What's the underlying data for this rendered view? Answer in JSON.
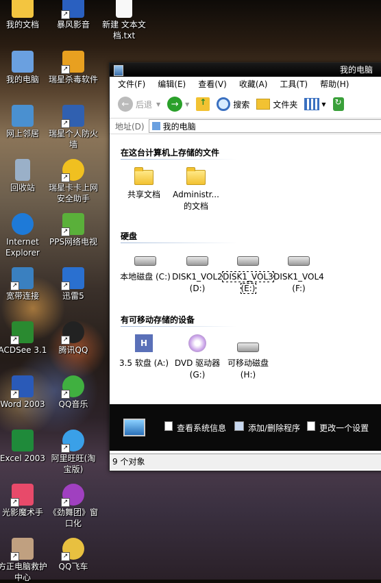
{
  "desktop": {
    "icons": [
      {
        "label": "我的文档",
        "color": "#f3c540"
      },
      {
        "label": "暴风影音",
        "color": "#2a60c0"
      },
      {
        "label": "新建 文本文档.txt",
        "color": "#f8f8f8"
      },
      {
        "label": "我的电脑",
        "color": "#6aa0e0"
      },
      {
        "label": "瑞星杀毒软件",
        "color": "#e8a020"
      },
      {
        "label": "网上邻居",
        "color": "#4a90d0"
      },
      {
        "label": "瑞星个人防火墙",
        "color": "#3060b0"
      },
      {
        "label": "回收站",
        "color": "#9ab0c8"
      },
      {
        "label": "瑞星卡卡上网安全助手",
        "color": "#f0c020"
      },
      {
        "label": "Internet Explorer",
        "color": "#1e7ad8"
      },
      {
        "label": "PPS网络电视",
        "color": "#5ab03a"
      },
      {
        "label": "宽带连接",
        "color": "#3a80c0"
      },
      {
        "label": "迅雷5",
        "color": "#2a70d0"
      },
      {
        "label": "ACDSee 3.1",
        "color": "#2a8a30"
      },
      {
        "label": "腾讯QQ",
        "color": "#222222"
      },
      {
        "label": "Word 2003",
        "color": "#2a5ab8"
      },
      {
        "label": "QQ音乐",
        "color": "#40b040"
      },
      {
        "label": "Excel 2003",
        "color": "#1f8a3a"
      },
      {
        "label": "阿里旺旺(淘宝版)",
        "color": "#3aa0e8"
      },
      {
        "label": "光影魔术手",
        "color": "#e84a6a"
      },
      {
        "label": "《劲舞团》窗口化",
        "color": "#a040c0"
      },
      {
        "label": "方正电脑救护中心",
        "color": "#c0a080"
      },
      {
        "label": "QQ飞车",
        "color": "#e8c040"
      }
    ]
  },
  "window": {
    "title": "我的电脑",
    "menu": [
      "文件(F)",
      "编辑(E)",
      "查看(V)",
      "收藏(A)",
      "工具(T)",
      "帮助(H)"
    ],
    "toolbar": {
      "back": "后退",
      "search": "搜索",
      "folders": "文件夹"
    },
    "address": {
      "label": "地址(D)",
      "value": "我的电脑"
    },
    "sections": {
      "files": {
        "title": "在这台计算机上存储的文件",
        "items": [
          "共享文档",
          "Administr... 的文档"
        ]
      },
      "disks": {
        "title": "硬盘",
        "items": [
          "本地磁盘 (C:)",
          "DISK1_VOL2 (D:)",
          "DISK1_VOL3 (E:)",
          "DISK1_VOL4 (F:)"
        ]
      },
      "removable": {
        "title": "有可移动存储的设备",
        "items": [
          "3.5 软盘 (A:)",
          "DVD 驱动器 (G:)",
          "可移动磁盘 (H:)"
        ]
      }
    },
    "tasks": [
      "查看系统信息",
      "添加/删除程序",
      "更改一个设置"
    ],
    "status": "9 个对象"
  }
}
